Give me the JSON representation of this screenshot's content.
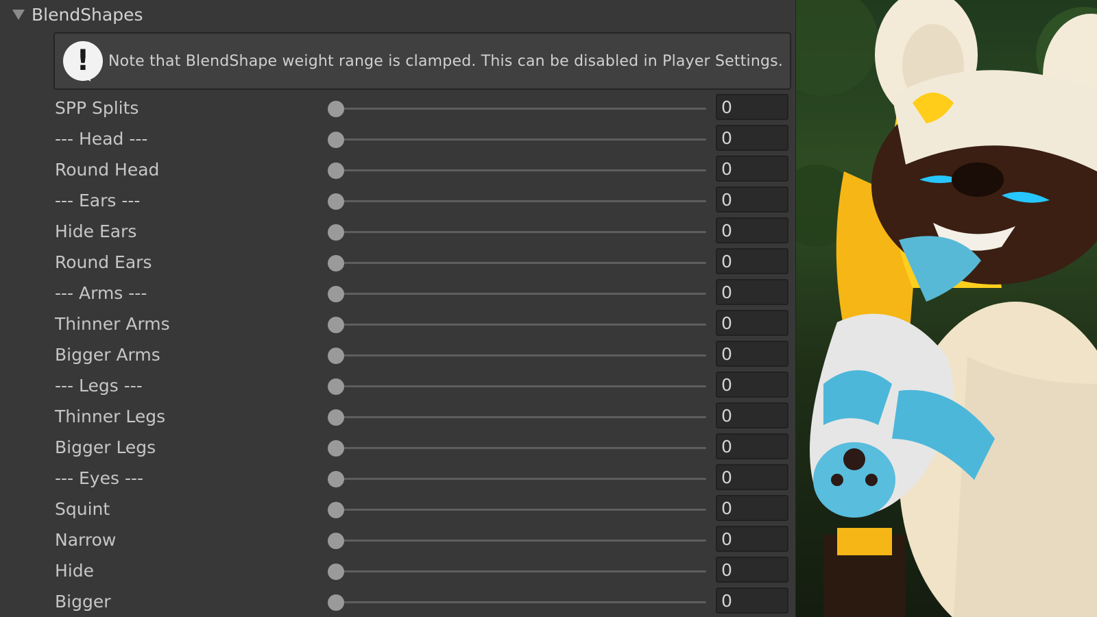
{
  "foldout": {
    "title": "BlendShapes",
    "expanded": true,
    "icon": "triangle-down-icon"
  },
  "helpbox": {
    "icon": "warning-icon",
    "message": "Note that BlendShape weight range is clamped. This can be disabled in Player Settings."
  },
  "blendshapes": [
    {
      "label": "SPP Splits",
      "value": "0"
    },
    {
      "label": "--- Head ---",
      "value": "0"
    },
    {
      "label": "Round Head",
      "value": "0"
    },
    {
      "label": "--- Ears ---",
      "value": "0"
    },
    {
      "label": "Hide Ears",
      "value": "0"
    },
    {
      "label": "Round Ears",
      "value": "0"
    },
    {
      "label": "--- Arms ---",
      "value": "0"
    },
    {
      "label": "Thinner Arms",
      "value": "0"
    },
    {
      "label": "Bigger Arms",
      "value": "0"
    },
    {
      "label": "--- Legs ---",
      "value": "0"
    },
    {
      "label": "Thinner Legs",
      "value": "0"
    },
    {
      "label": "Bigger Legs",
      "value": "0"
    },
    {
      "label": "--- Eyes ---",
      "value": "0"
    },
    {
      "label": "Squint",
      "value": "0"
    },
    {
      "label": "Narrow",
      "value": "0"
    },
    {
      "label": "Hide",
      "value": "0"
    },
    {
      "label": "Bigger",
      "value": "0"
    }
  ],
  "colors": {
    "panel_bg": "#383838",
    "field_bg": "#2a2a2a",
    "text": "#c6c6c6"
  }
}
